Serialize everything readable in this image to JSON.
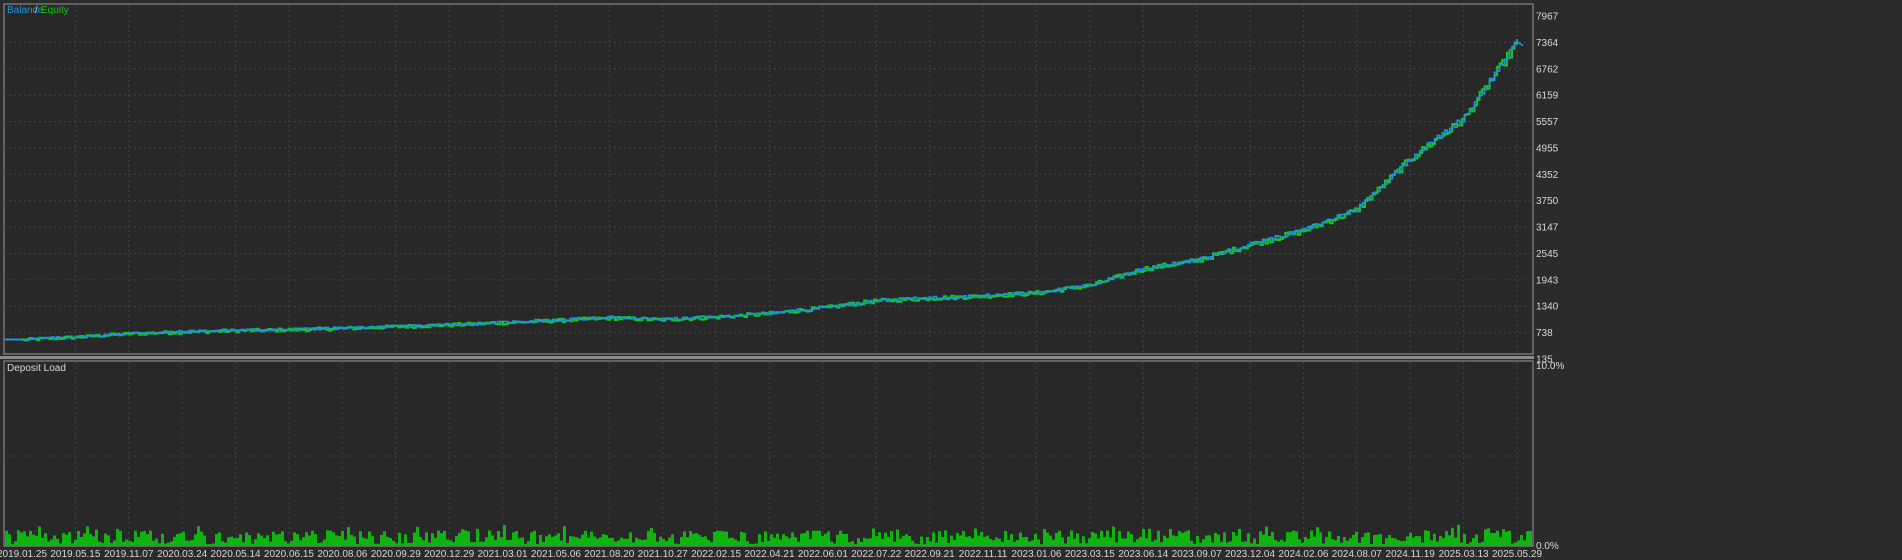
{
  "colors": {
    "background": "#2b2b2b",
    "plot_background": "#282828",
    "border": "#9a9a9a",
    "grid": "#444444",
    "balance": "#1e96dc",
    "equity": "#14c814",
    "deposit_load": "#10b410",
    "text": "#d8d8d8",
    "separator": "#8a8a8a"
  },
  "chart_data": [
    {
      "type": "line",
      "legend": [
        {
          "name": "Balance",
          "color": "#1e96dc"
        },
        {
          "name": "Equity",
          "color": "#14c814"
        }
      ],
      "legend_separator": "/",
      "legend_position": "top-left",
      "grid": true,
      "ylim": [
        135,
        7967
      ],
      "yticks": [
        "7967",
        "7364",
        "6762",
        "6159",
        "5557",
        "4955",
        "4352",
        "3750",
        "3147",
        "2545",
        "1943",
        "1340",
        "738",
        "135"
      ],
      "xticks": [
        "2019.01.25",
        "2019.05.15",
        "2019.11.07",
        "2020.03.24",
        "2020.05.14",
        "2020.06.15",
        "2020.08.06",
        "2020.09.29",
        "2020.12.29",
        "2021.03.01",
        "2021.05.06",
        "2021.08.20",
        "2021.10.27",
        "2022.02.15",
        "2022.04.21",
        "2022.06.01",
        "2022.07.22",
        "2022.09.21",
        "2022.11.11",
        "2023.01.06",
        "2023.03.15",
        "2023.06.14",
        "2023.09.07",
        "2023.12.04",
        "2024.02.06",
        "2024.08.07",
        "2024.11.19",
        "2025.03.13",
        "2025.05.29"
      ],
      "series": [
        {
          "name": "Balance",
          "x": [
            0,
            1,
            2,
            3,
            4,
            5,
            6,
            7,
            8,
            9,
            10,
            11,
            12,
            13,
            14,
            15,
            16,
            17,
            18,
            19,
            20,
            21,
            22,
            23,
            24,
            25,
            26,
            27,
            28
          ],
          "values": [
            580,
            640,
            720,
            760,
            790,
            810,
            840,
            880,
            920,
            970,
            1020,
            1080,
            1040,
            1100,
            1180,
            1310,
            1470,
            1530,
            1580,
            1650,
            1820,
            2200,
            2390,
            2760,
            3080,
            3560,
            4720,
            5640,
            7380
          ]
        },
        {
          "name": "Equity",
          "x": [
            0,
            1,
            2,
            3,
            4,
            5,
            6,
            7,
            8,
            9,
            10,
            11,
            12,
            13,
            14,
            15,
            16,
            17,
            18,
            19,
            20,
            21,
            22,
            23,
            24,
            25,
            26,
            27,
            28
          ],
          "values": [
            570,
            630,
            710,
            750,
            780,
            800,
            830,
            870,
            910,
            960,
            1010,
            1070,
            1030,
            1090,
            1170,
            1300,
            1460,
            1520,
            1570,
            1640,
            1810,
            2190,
            2380,
            2740,
            3060,
            3540,
            4700,
            5610,
            7350
          ]
        }
      ]
    },
    {
      "type": "bar",
      "title": "Deposit Load",
      "ylim": [
        0,
        10
      ],
      "yticks": [
        "10.0%",
        "0.0%"
      ],
      "typical_range": [
        0.1,
        1.2
      ],
      "grid": true
    }
  ]
}
